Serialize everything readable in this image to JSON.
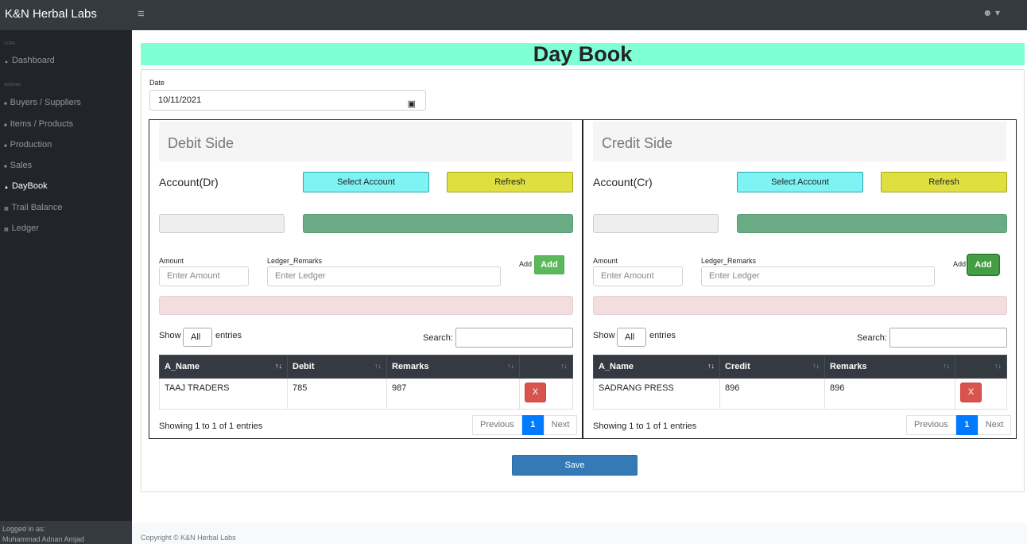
{
  "app": {
    "title": "K&N Herbal Labs"
  },
  "sidebar": {
    "core_heading": "CORE",
    "addons_heading": "ADDONS",
    "items": [
      {
        "label": "Dashboard"
      },
      {
        "label": "Buyers / Suppliers"
      },
      {
        "label": "Items / Products"
      },
      {
        "label": "Production"
      },
      {
        "label": "Sales"
      },
      {
        "label": "DayBook"
      },
      {
        "label": "Trail Balance"
      },
      {
        "label": "Ledger"
      }
    ],
    "active": "DayBook",
    "footer": {
      "logged_in_label": "Logged in as:",
      "user": "Muhammad Adnan Amjad"
    }
  },
  "page": {
    "title": "Day Book",
    "date_label": "Date",
    "date_value": "10/11/2021",
    "save_label": "Save"
  },
  "debit": {
    "title": "Debit Side",
    "account_label": "Account(Dr)",
    "select_label": "Select Account",
    "refresh_label": "Refresh",
    "amount_label": "Amount",
    "amount_placeholder": "Enter Amount",
    "remarks_label": "Ledger_Remarks",
    "remarks_placeholder": "Enter Ledger",
    "add_text": "Add",
    "add_button": "Add",
    "show": "Show",
    "show_value": "All",
    "entries": "entries",
    "search_label": "Search:",
    "columns": [
      "A_Name",
      "Debit",
      "Remarks",
      ""
    ],
    "rows": [
      {
        "name": "TAAJ TRADERS",
        "amount": "785",
        "remarks": "987"
      }
    ],
    "delete_label": "X",
    "info": "Showing 1 to 1 of 1 entries",
    "prev": "Previous",
    "page": "1",
    "next": "Next"
  },
  "credit": {
    "title": "Credit Side",
    "account_label": "Account(Cr)",
    "select_label": "Select Account",
    "refresh_label": "Refresh",
    "amount_label": "Amount",
    "amount_placeholder": "Enter Amount",
    "remarks_label": "Ledger_Remarks",
    "remarks_placeholder": "Enter Ledger",
    "add_text": "Add",
    "add_button": "Add",
    "show": "Show",
    "show_value": "All",
    "entries": "entries",
    "search_label": "Search:",
    "columns": [
      "A_Name",
      "Credit",
      "Remarks",
      ""
    ],
    "rows": [
      {
        "name": "SADRANG PRESS",
        "amount": "896",
        "remarks": "896"
      }
    ],
    "delete_label": "X",
    "info": "Showing 1 to 1 of 1 entries",
    "prev": "Previous",
    "page": "1",
    "next": "Next"
  },
  "footer": {
    "copyright": "Copyright © K&N Herbal Labs"
  },
  "colors": {
    "title_band": "#7fffd4",
    "select": "#7ef3f3",
    "refresh": "#dfdf3f",
    "add": "#5cb85c",
    "delete": "#d9534f",
    "save": "#337ab7"
  }
}
